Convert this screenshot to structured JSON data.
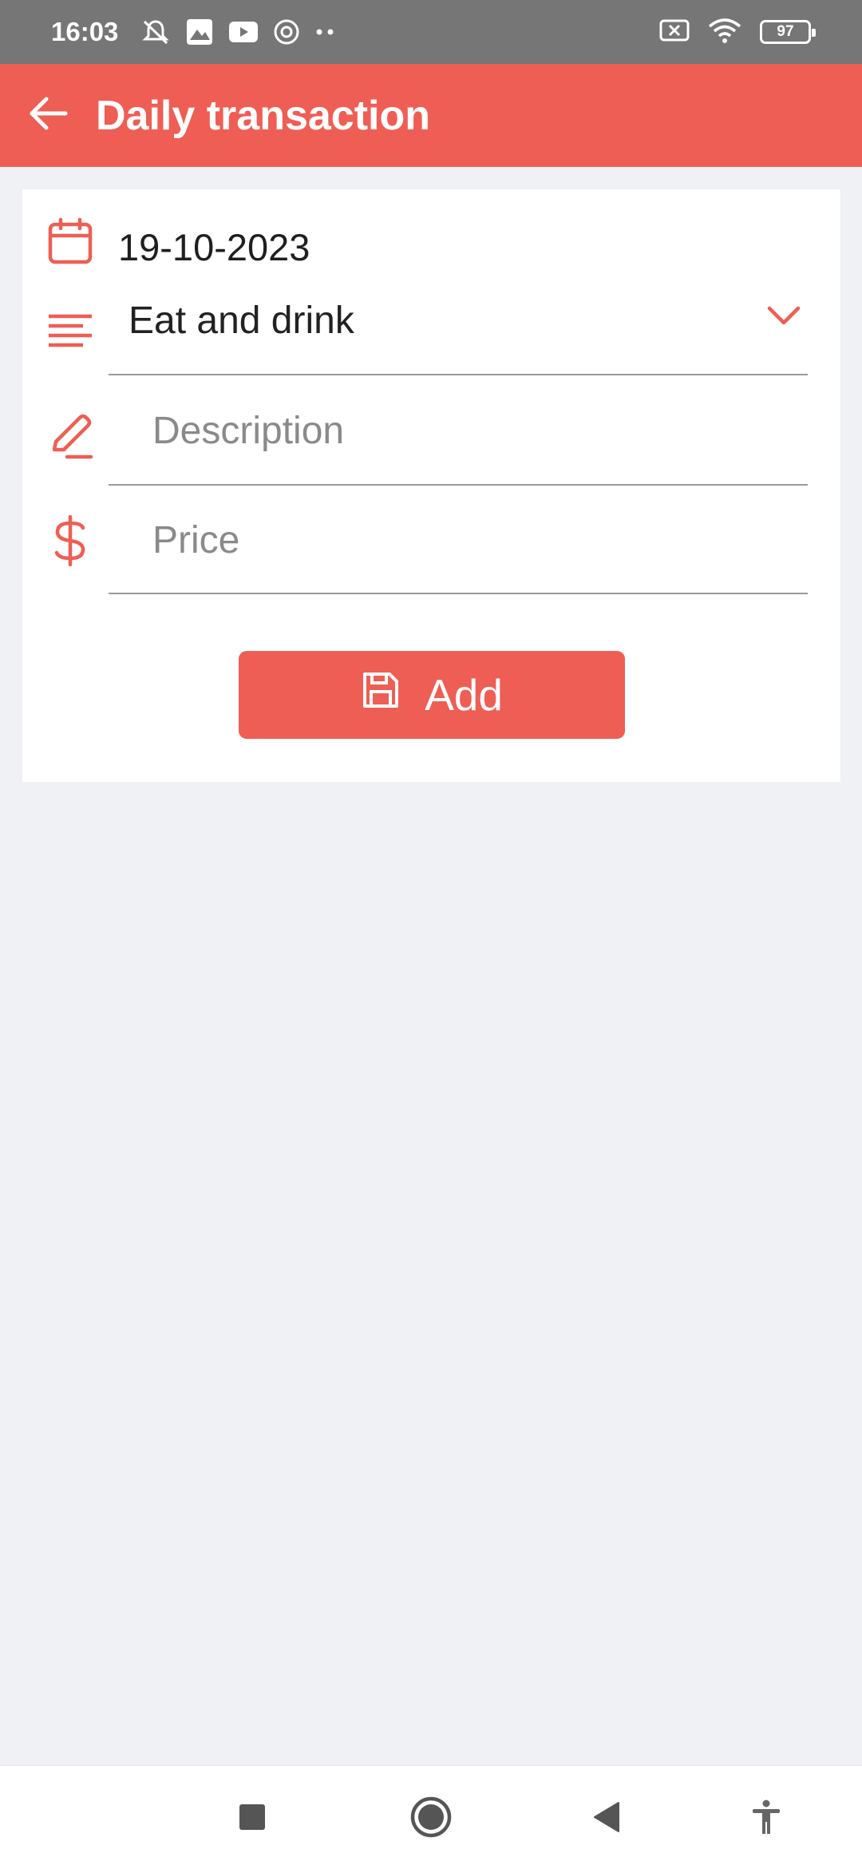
{
  "status_bar": {
    "time": "16:03",
    "battery": "97",
    "left_icons": [
      "mute-icon",
      "gallery-icon",
      "youtube-icon",
      "chrome-icon",
      "more-dots-icon"
    ],
    "right_icons": [
      "sim-icon",
      "wifi-icon",
      "battery-icon"
    ]
  },
  "app_bar": {
    "title": "Daily transaction",
    "back_icon": "arrow-left-icon",
    "color": "#ef5e54"
  },
  "form": {
    "date": "19-10-2023",
    "category": "Eat and drink",
    "description_placeholder": "Description",
    "price_placeholder": "Price",
    "add_label": "Add",
    "accent_color": "#ef5e54"
  },
  "nav_bar": {
    "items": [
      "recents-square-icon",
      "home-circle-icon",
      "back-triangle-icon",
      "accessibility-icon"
    ]
  }
}
